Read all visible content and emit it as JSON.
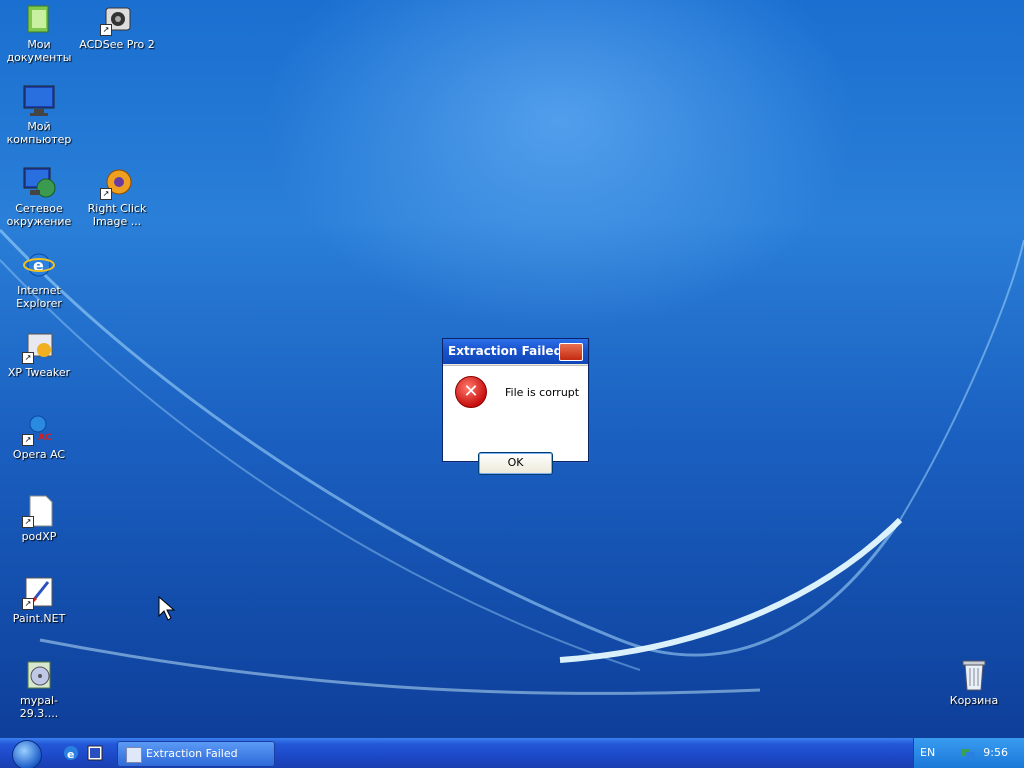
{
  "desktop": {
    "icons": [
      {
        "label": "Мои документы"
      },
      {
        "label": "ACDSee Pro 2"
      },
      {
        "label": "Мой компьютер"
      },
      {
        "label": "Сетевое окружение"
      },
      {
        "label": "Right Click Image ..."
      },
      {
        "label": "Internet Explorer"
      },
      {
        "label": "XP Tweaker"
      },
      {
        "label": "Opera AC"
      },
      {
        "label": "podXP"
      },
      {
        "label": "Paint.NET"
      },
      {
        "label": "mypal-29.3...."
      },
      {
        "label": "Корзина"
      }
    ]
  },
  "dialog": {
    "title": "Extraction Failed",
    "message": "File is corrupt",
    "ok_label": "OK",
    "icon": "error-icon"
  },
  "taskbar": {
    "task_title": "Extraction Failed",
    "language": "EN",
    "clock": "9:56"
  },
  "colors": {
    "desktop_blue": "#1a6fd0",
    "taskbar_blue": "#2458d8",
    "dialog_face": "#ece9d8",
    "error_red": "#c81010"
  }
}
